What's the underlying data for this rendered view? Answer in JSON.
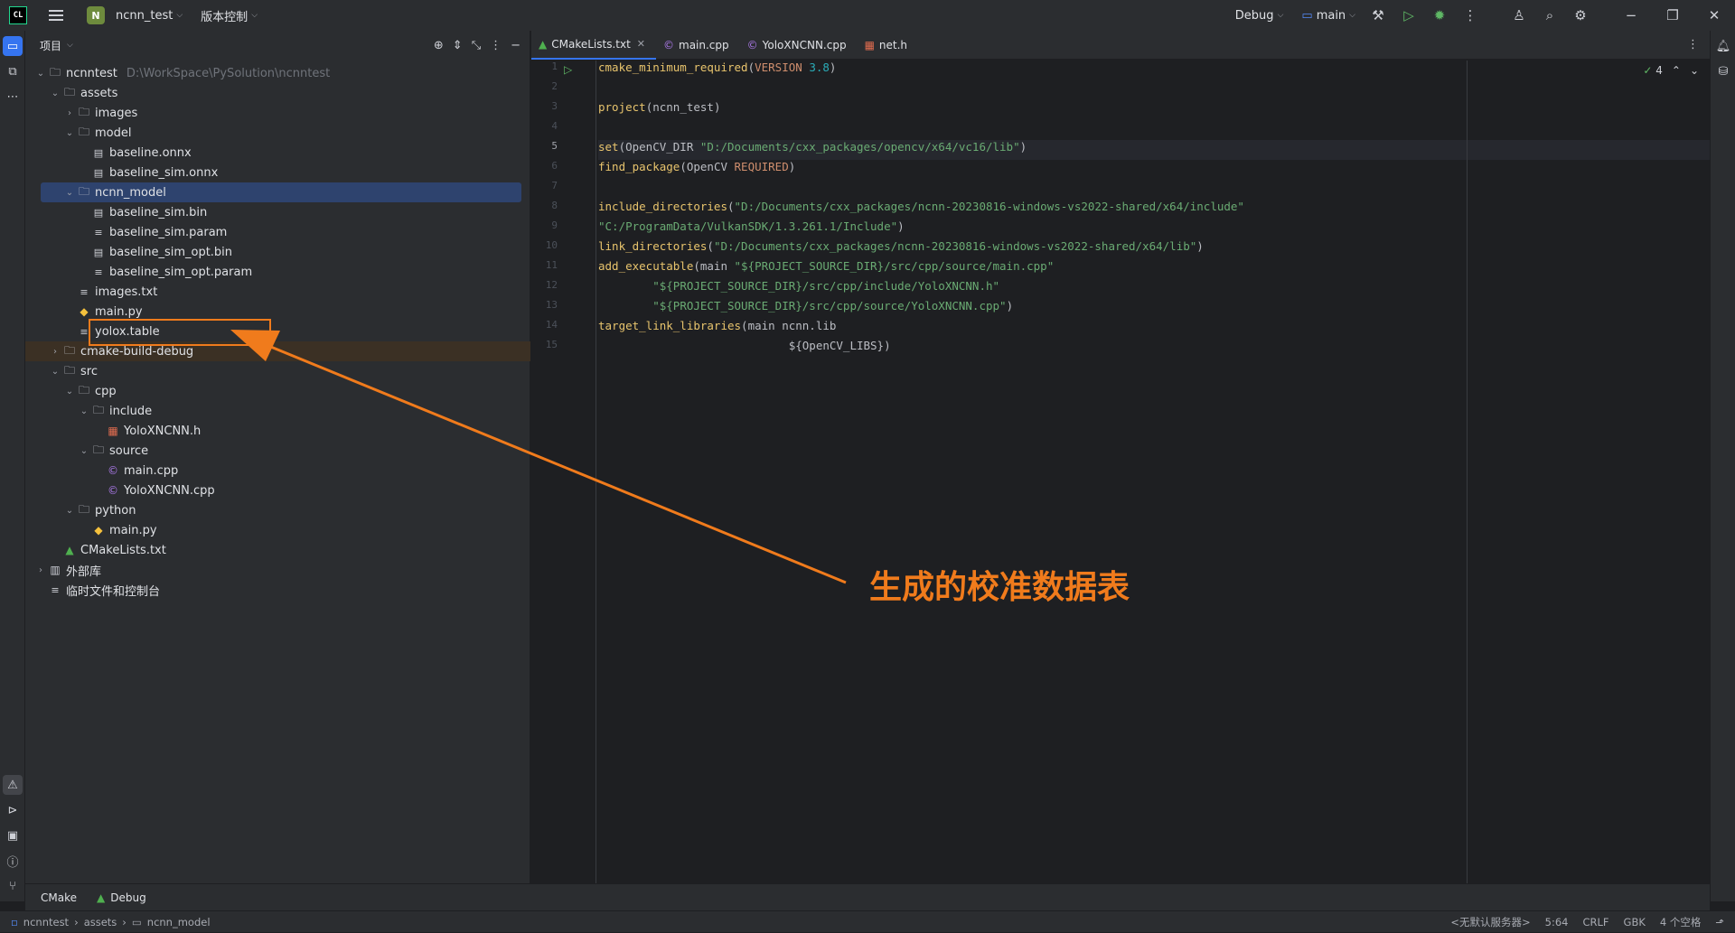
{
  "titlebar": {
    "logo": "CL",
    "project_badge": "N",
    "project_name": "ncnn_test",
    "vcs_label": "版本控制",
    "run_config": "Debug",
    "branch": "main"
  },
  "panel": {
    "title": "项目"
  },
  "tree": [
    {
      "label": "ncnntest",
      "hint": "D:\\WorkSpace\\PySolution\\ncnntest",
      "icon": "folder",
      "depth": 0,
      "toggle": "v"
    },
    {
      "label": "assets",
      "icon": "folder",
      "depth": 1,
      "toggle": "v"
    },
    {
      "label": "images",
      "icon": "folder",
      "depth": 2,
      "toggle": ">"
    },
    {
      "label": "model",
      "icon": "folder",
      "depth": 2,
      "toggle": "v"
    },
    {
      "label": "baseline.onnx",
      "icon": "file",
      "depth": 3,
      "toggle": ""
    },
    {
      "label": "baseline_sim.onnx",
      "icon": "file",
      "depth": 3,
      "toggle": ""
    },
    {
      "label": "ncnn_model",
      "icon": "folder",
      "depth": 2,
      "toggle": "v",
      "selected": true
    },
    {
      "label": "baseline_sim.bin",
      "icon": "file",
      "depth": 3,
      "toggle": ""
    },
    {
      "label": "baseline_sim.param",
      "icon": "text",
      "depth": 3,
      "toggle": ""
    },
    {
      "label": "baseline_sim_opt.bin",
      "icon": "file",
      "depth": 3,
      "toggle": ""
    },
    {
      "label": "baseline_sim_opt.param",
      "icon": "text",
      "depth": 3,
      "toggle": ""
    },
    {
      "label": "images.txt",
      "icon": "text",
      "depth": 2,
      "toggle": ""
    },
    {
      "label": "main.py",
      "icon": "py",
      "depth": 2,
      "toggle": ""
    },
    {
      "label": "yolox.table",
      "icon": "text",
      "depth": 2,
      "toggle": ""
    },
    {
      "label": "cmake-build-debug",
      "icon": "folder",
      "depth": 1,
      "toggle": ">",
      "orange": true
    },
    {
      "label": "src",
      "icon": "folder",
      "depth": 1,
      "toggle": "v"
    },
    {
      "label": "cpp",
      "icon": "folder",
      "depth": 2,
      "toggle": "v"
    },
    {
      "label": "include",
      "icon": "folder",
      "depth": 3,
      "toggle": "v"
    },
    {
      "label": "YoloXNCNN.h",
      "icon": "h",
      "depth": 4,
      "toggle": ""
    },
    {
      "label": "source",
      "icon": "folder",
      "depth": 3,
      "toggle": "v"
    },
    {
      "label": "main.cpp",
      "icon": "cpp",
      "depth": 4,
      "toggle": ""
    },
    {
      "label": "YoloXNCNN.cpp",
      "icon": "cpp",
      "depth": 4,
      "toggle": ""
    },
    {
      "label": "python",
      "icon": "folder",
      "depth": 2,
      "toggle": "v"
    },
    {
      "label": "main.py",
      "icon": "py",
      "depth": 3,
      "toggle": ""
    },
    {
      "label": "CMakeLists.txt",
      "icon": "cmake",
      "depth": 1,
      "toggle": ""
    },
    {
      "label": "外部库",
      "icon": "lib",
      "depth": 0,
      "toggle": ">"
    },
    {
      "label": "临时文件和控制台",
      "icon": "scratch",
      "depth": 0,
      "toggle": ""
    }
  ],
  "tabs": [
    {
      "label": "CMakeLists.txt",
      "icon": "cmake",
      "active": true
    },
    {
      "label": "main.cpp",
      "icon": "cpp"
    },
    {
      "label": "YoloXNCNN.cpp",
      "icon": "cpp"
    },
    {
      "label": "net.h",
      "icon": "h"
    }
  ],
  "inspection_count": "4",
  "code_lines": [
    "cmake_minimum_required(VERSION 3.8)",
    "",
    "project(ncnn_test)",
    "",
    "set(OpenCV_DIR \"D:/Documents/cxx_packages/opencv/x64/vc16/lib\")",
    "find_package(OpenCV REQUIRED)",
    "",
    "include_directories(\"D:/Documents/cxx_packages/ncnn-20230816-windows-vs2022-shared/x64/include\"",
    "\"C:/ProgramData/VulkanSDK/1.3.261.1/Include\")",
    "link_directories(\"D:/Documents/cxx_packages/ncnn-20230816-windows-vs2022-shared/x64/lib\")",
    "add_executable(main \"${PROJECT_SOURCE_DIR}/src/cpp/source/main.cpp\"",
    "        \"${PROJECT_SOURCE_DIR}/src/cpp/include/YoloXNCNN.h\"",
    "        \"${PROJECT_SOURCE_DIR}/src/cpp/source/YoloXNCNN.cpp\")",
    "target_link_libraries(main ncnn.lib",
    "                            ${OpenCV_LIBS})"
  ],
  "current_line": 5,
  "bottom_tabs": [
    {
      "label": "CMake"
    },
    {
      "label": "Debug"
    }
  ],
  "breadcrumb": [
    "ncnntest",
    "assets",
    "ncnn_model"
  ],
  "status": {
    "server": "<无默认服务器>",
    "position": "5:64",
    "line_sep": "CRLF",
    "encoding": "GBK",
    "indent": "4 个空格"
  },
  "annotation": {
    "text": "生成的校准数据表",
    "color": "#f07b1c"
  }
}
